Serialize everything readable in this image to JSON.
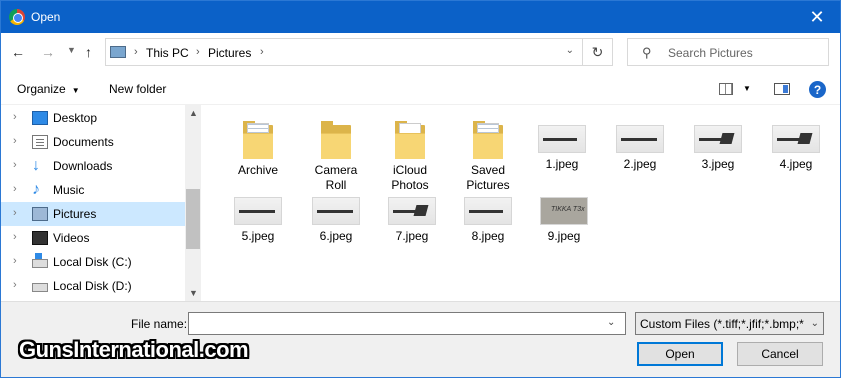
{
  "window": {
    "title": "Open",
    "close_icon": "close-icon",
    "app_icon": "chrome-icon"
  },
  "nav": {
    "breadcrumb": [
      "This PC",
      "Pictures"
    ],
    "search_placeholder": "Search Pictures"
  },
  "toolbar": {
    "organize_label": "Organize",
    "new_folder_label": "New folder"
  },
  "sidebar": {
    "items": [
      {
        "label": "Desktop",
        "icon": "desktop-icon"
      },
      {
        "label": "Documents",
        "icon": "documents-icon"
      },
      {
        "label": "Downloads",
        "icon": "downloads-icon"
      },
      {
        "label": "Music",
        "icon": "music-icon"
      },
      {
        "label": "Pictures",
        "icon": "pictures-icon",
        "selected": true
      },
      {
        "label": "Videos",
        "icon": "videos-icon"
      },
      {
        "label": "Local Disk (C:)",
        "icon": "disk-icon"
      },
      {
        "label": "Local Disk (D:)",
        "icon": "disk-icon"
      }
    ]
  },
  "content": {
    "folders": [
      {
        "label_line1": "Archive",
        "label_line2": ""
      },
      {
        "label_line1": "Camera",
        "label_line2": "Roll"
      },
      {
        "label_line1": "iCloud",
        "label_line2": "Photos"
      },
      {
        "label_line1": "Saved",
        "label_line2": "Pictures"
      }
    ],
    "files": [
      "1.jpeg",
      "2.jpeg",
      "3.jpeg",
      "4.jpeg",
      "5.jpeg",
      "6.jpeg",
      "7.jpeg",
      "8.jpeg",
      "9.jpeg"
    ],
    "thumb9_text": "TIKKA T3x"
  },
  "bottom": {
    "file_name_label": "File name:",
    "file_name_value": "",
    "filter_value": "Custom Files (*.tiff;*.jfif;*.bmp;*",
    "open_label": "Open",
    "cancel_label": "Cancel"
  },
  "watermark": "GunsInternational.com"
}
